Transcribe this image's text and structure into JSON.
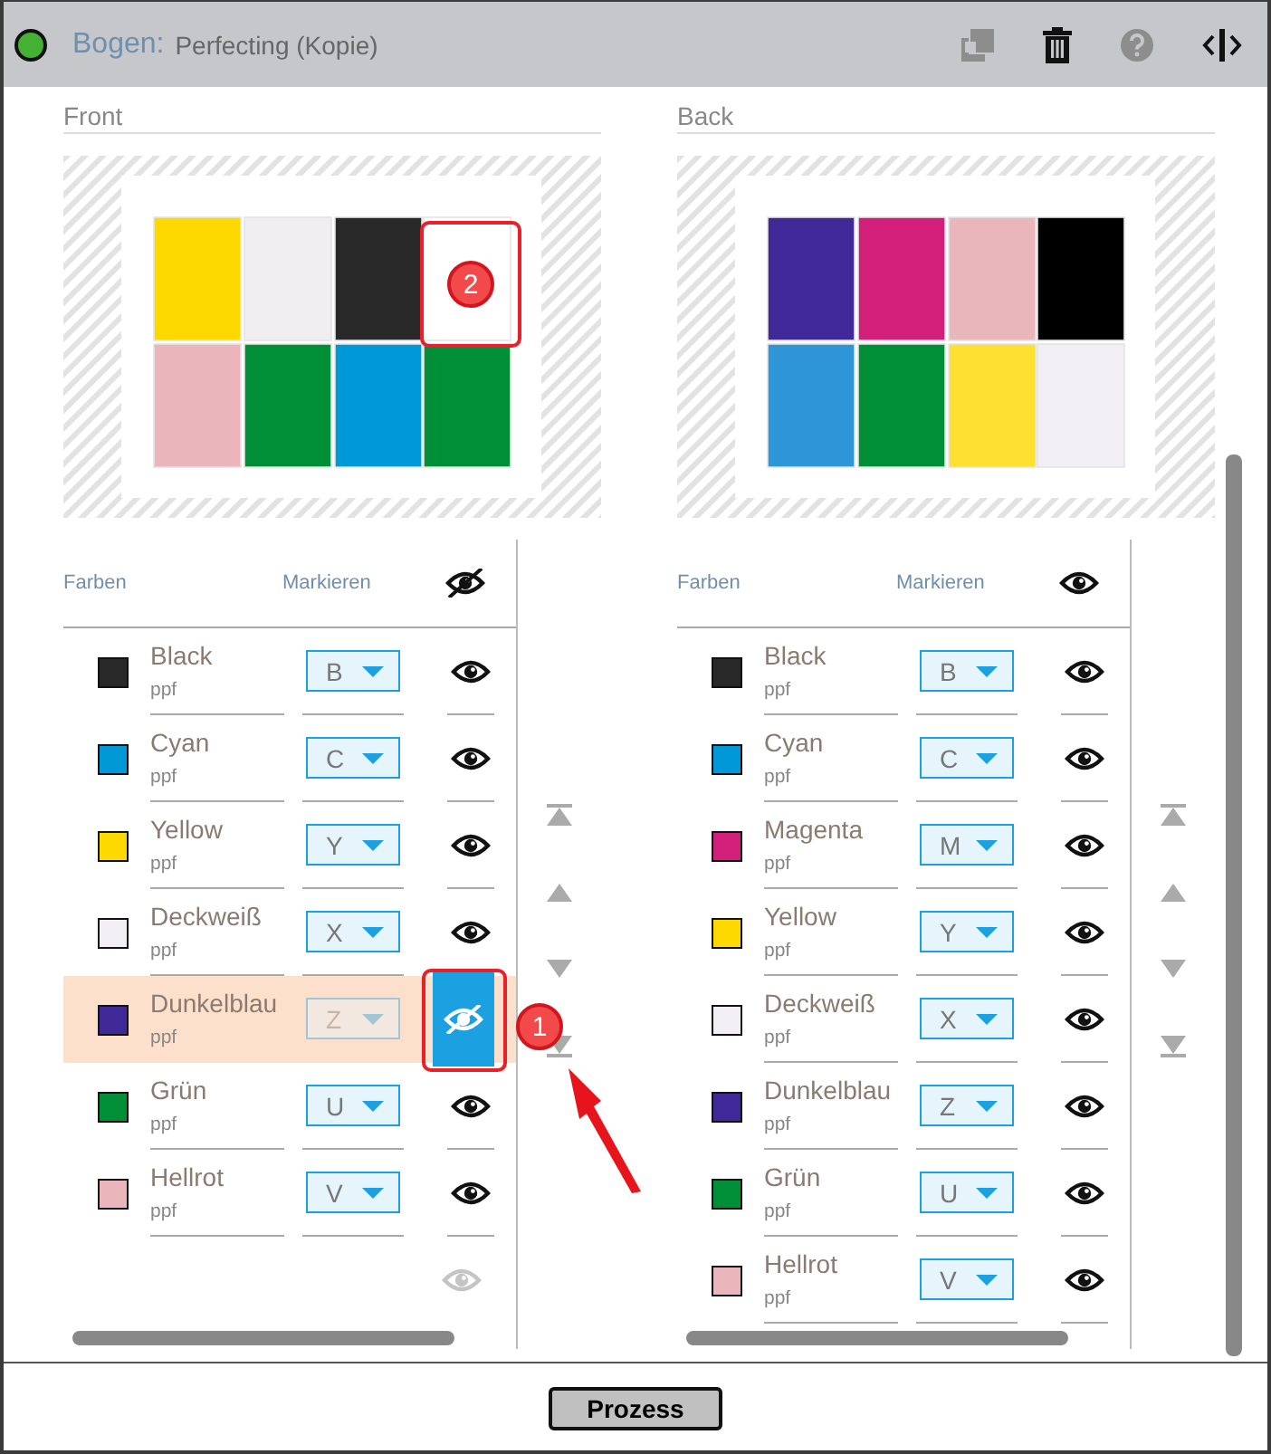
{
  "header": {
    "status_dot": {
      "color": "#44b034"
    },
    "label": "Bogen:",
    "title": "Perfecting (Kopie)",
    "tools": [
      {
        "kind": "duplicate",
        "disabled": true
      },
      {
        "kind": "delete",
        "disabled": false
      },
      {
        "kind": "help",
        "disabled": true
      },
      {
        "kind": "split",
        "disabled": false
      }
    ]
  },
  "panels": [
    {
      "title": "Front",
      "patches": [
        {
          "color": "#fdd900"
        },
        {
          "color": "#f0eef1"
        },
        {
          "color": "#282828"
        },
        {
          "color": "#ffffff",
          "callout": "2"
        },
        {
          "color": "#ebb6bb"
        },
        {
          "color": "#008f36"
        },
        {
          "color": "#0098d6"
        },
        {
          "color": "#008f36"
        }
      ],
      "colors_heading": "Farben",
      "mark_heading": "Markieren",
      "all_visible": false,
      "spare_eye": true,
      "rows": [
        {
          "name": "Black",
          "type": "ppf",
          "color": "#282828",
          "mark": "B",
          "visible": true,
          "selected": false
        },
        {
          "name": "Cyan",
          "type": "ppf",
          "color": "#0098d6",
          "mark": "C",
          "visible": true,
          "selected": false
        },
        {
          "name": "Yellow",
          "type": "ppf",
          "color": "#fdd900",
          "mark": "Y",
          "visible": true,
          "selected": false
        },
        {
          "name": "Deckweiß",
          "type": "ppf",
          "color": "#f1eef4",
          "mark": "X",
          "visible": true,
          "selected": false
        },
        {
          "name": "Dunkelblau",
          "type": "ppf",
          "color": "#3f2898",
          "mark": "Z",
          "visible": false,
          "selected": true,
          "callout": "1"
        },
        {
          "name": "Grün",
          "type": "ppf",
          "color": "#008f36",
          "mark": "U",
          "visible": true,
          "selected": false
        },
        {
          "name": "Hellrot",
          "type": "ppf",
          "color": "#ebb6bb",
          "mark": "V",
          "visible": true,
          "selected": false
        }
      ]
    },
    {
      "title": "Back",
      "patches": [
        {
          "color": "#3f2898"
        },
        {
          "color": "#d11f7a"
        },
        {
          "color": "#e9b6bb"
        },
        {
          "color": "#000000"
        },
        {
          "color": "#2e95d8"
        },
        {
          "color": "#008f36"
        },
        {
          "color": "#fde030"
        },
        {
          "color": "#f1eef4"
        }
      ],
      "colors_heading": "Farben",
      "mark_heading": "Markieren",
      "all_visible": true,
      "rows": [
        {
          "name": "Black",
          "type": "ppf",
          "color": "#282828",
          "mark": "B",
          "visible": true,
          "selected": false
        },
        {
          "name": "Cyan",
          "type": "ppf",
          "color": "#0098d6",
          "mark": "C",
          "visible": true,
          "selected": false
        },
        {
          "name": "Magenta",
          "type": "ppf",
          "color": "#d11f7a",
          "mark": "M",
          "visible": true,
          "selected": false
        },
        {
          "name": "Yellow",
          "type": "ppf",
          "color": "#fdd900",
          "mark": "Y",
          "visible": true,
          "selected": false
        },
        {
          "name": "Deckweiß",
          "type": "ppf",
          "color": "#f1eef4",
          "mark": "X",
          "visible": true,
          "selected": false
        },
        {
          "name": "Dunkelblau",
          "type": "ppf",
          "color": "#3f2898",
          "mark": "Z",
          "visible": true,
          "selected": false
        },
        {
          "name": "Grün",
          "type": "ppf",
          "color": "#008f36",
          "mark": "U",
          "visible": true,
          "selected": false
        },
        {
          "name": "Hellrot",
          "type": "ppf",
          "color": "#ebb6bb",
          "mark": "V",
          "visible": true,
          "selected": false
        }
      ]
    }
  ],
  "footer": {
    "button": "Prozess"
  }
}
